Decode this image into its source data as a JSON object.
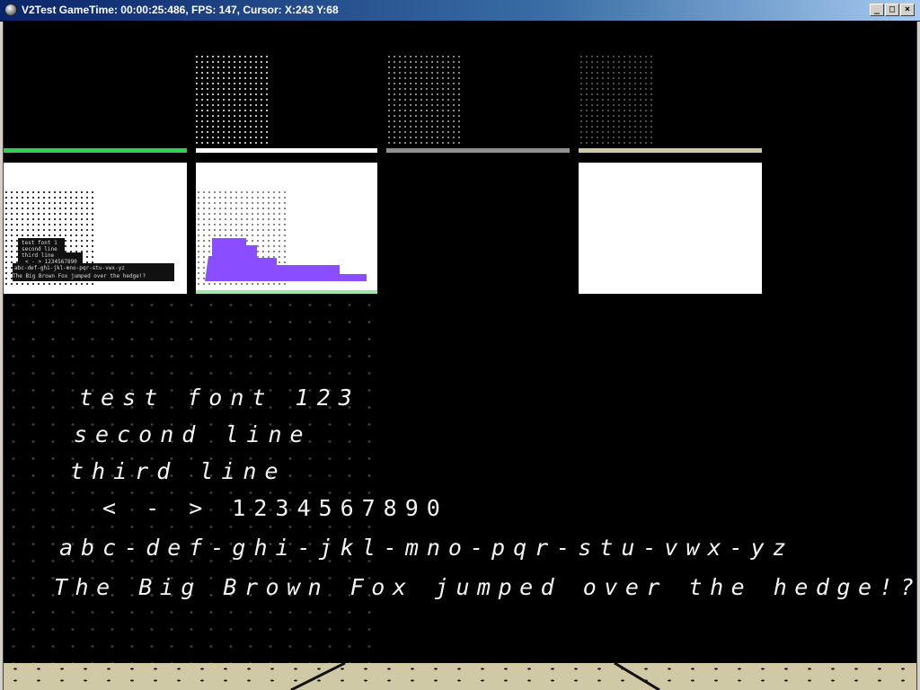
{
  "window": {
    "title": "V2Test GameTime: 00:00:25:486, FPS: 147, Cursor: X:243 Y:68",
    "buttons": {
      "minimize": "_",
      "maximize": "□",
      "close": "×"
    }
  },
  "scene": {
    "strip_colors": [
      "#33cc55",
      "#ffffff",
      "#909090",
      "#cfc9a6"
    ],
    "accent_purple": "#8a4dff",
    "panel_green_edge": "#9be8a8"
  },
  "thumbnail_text": {
    "line1": "test font 1",
    "line2": "second line",
    "line3": "third line",
    "line4": "< - > 1234567890",
    "line5": "abc-def-ghi-jkl-mno-pqr-stu-vwx-yz",
    "line6": "The Big Brown Fox jumped over the hedge!?"
  },
  "font_test": {
    "line1": "test font 123",
    "line2": "second line",
    "line3": "third line",
    "line4": "< - > 1234567890",
    "line5": "abc-def-ghi-jkl-mno-pqr-stu-vwx-yz",
    "line6": "The Big Brown Fox jumped over the hedge!?"
  }
}
